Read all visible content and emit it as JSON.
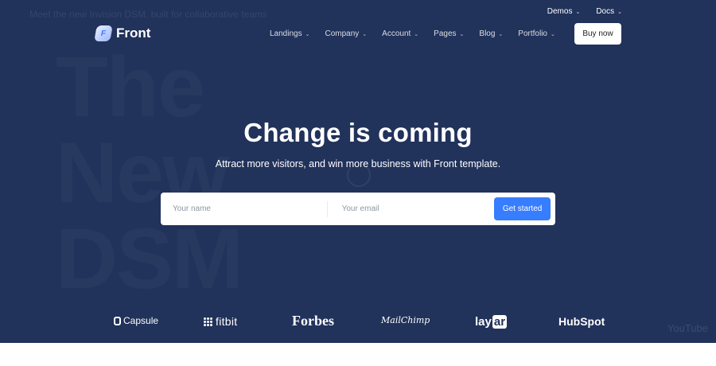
{
  "background": {
    "caption": "Meet the new Invision DSM, built for collaborative teams",
    "watermark_lines": [
      "The",
      "New",
      "DSM"
    ],
    "video_badge": "YouTube"
  },
  "topbar": {
    "items": [
      {
        "label": "Demos",
        "icon": "chevron-down-icon"
      },
      {
        "label": "Docs",
        "icon": "chevron-down-icon"
      }
    ]
  },
  "brand": {
    "name": "Front",
    "mark": "F"
  },
  "nav": {
    "items": [
      {
        "label": "Landings"
      },
      {
        "label": "Company"
      },
      {
        "label": "Account"
      },
      {
        "label": "Pages"
      },
      {
        "label": "Blog"
      },
      {
        "label": "Portfolio"
      }
    ],
    "buy_label": "Buy now"
  },
  "hero": {
    "title": "Change is coming",
    "subtitle": "Attract more visitors, and win more business with Front template."
  },
  "form": {
    "name_placeholder": "Your name",
    "email_placeholder": "Your email",
    "submit_label": "Get started"
  },
  "logos": {
    "capsule": "Capsule",
    "fitbit": "fitbit",
    "forbes": "Forbes",
    "mailchimp": "MailChimp",
    "layar_a": "lay",
    "layar_b": "ar",
    "hubspot": "HubSpot"
  },
  "colors": {
    "hero_bg": "#21325b",
    "primary": "#377dff",
    "white": "#ffffff"
  }
}
